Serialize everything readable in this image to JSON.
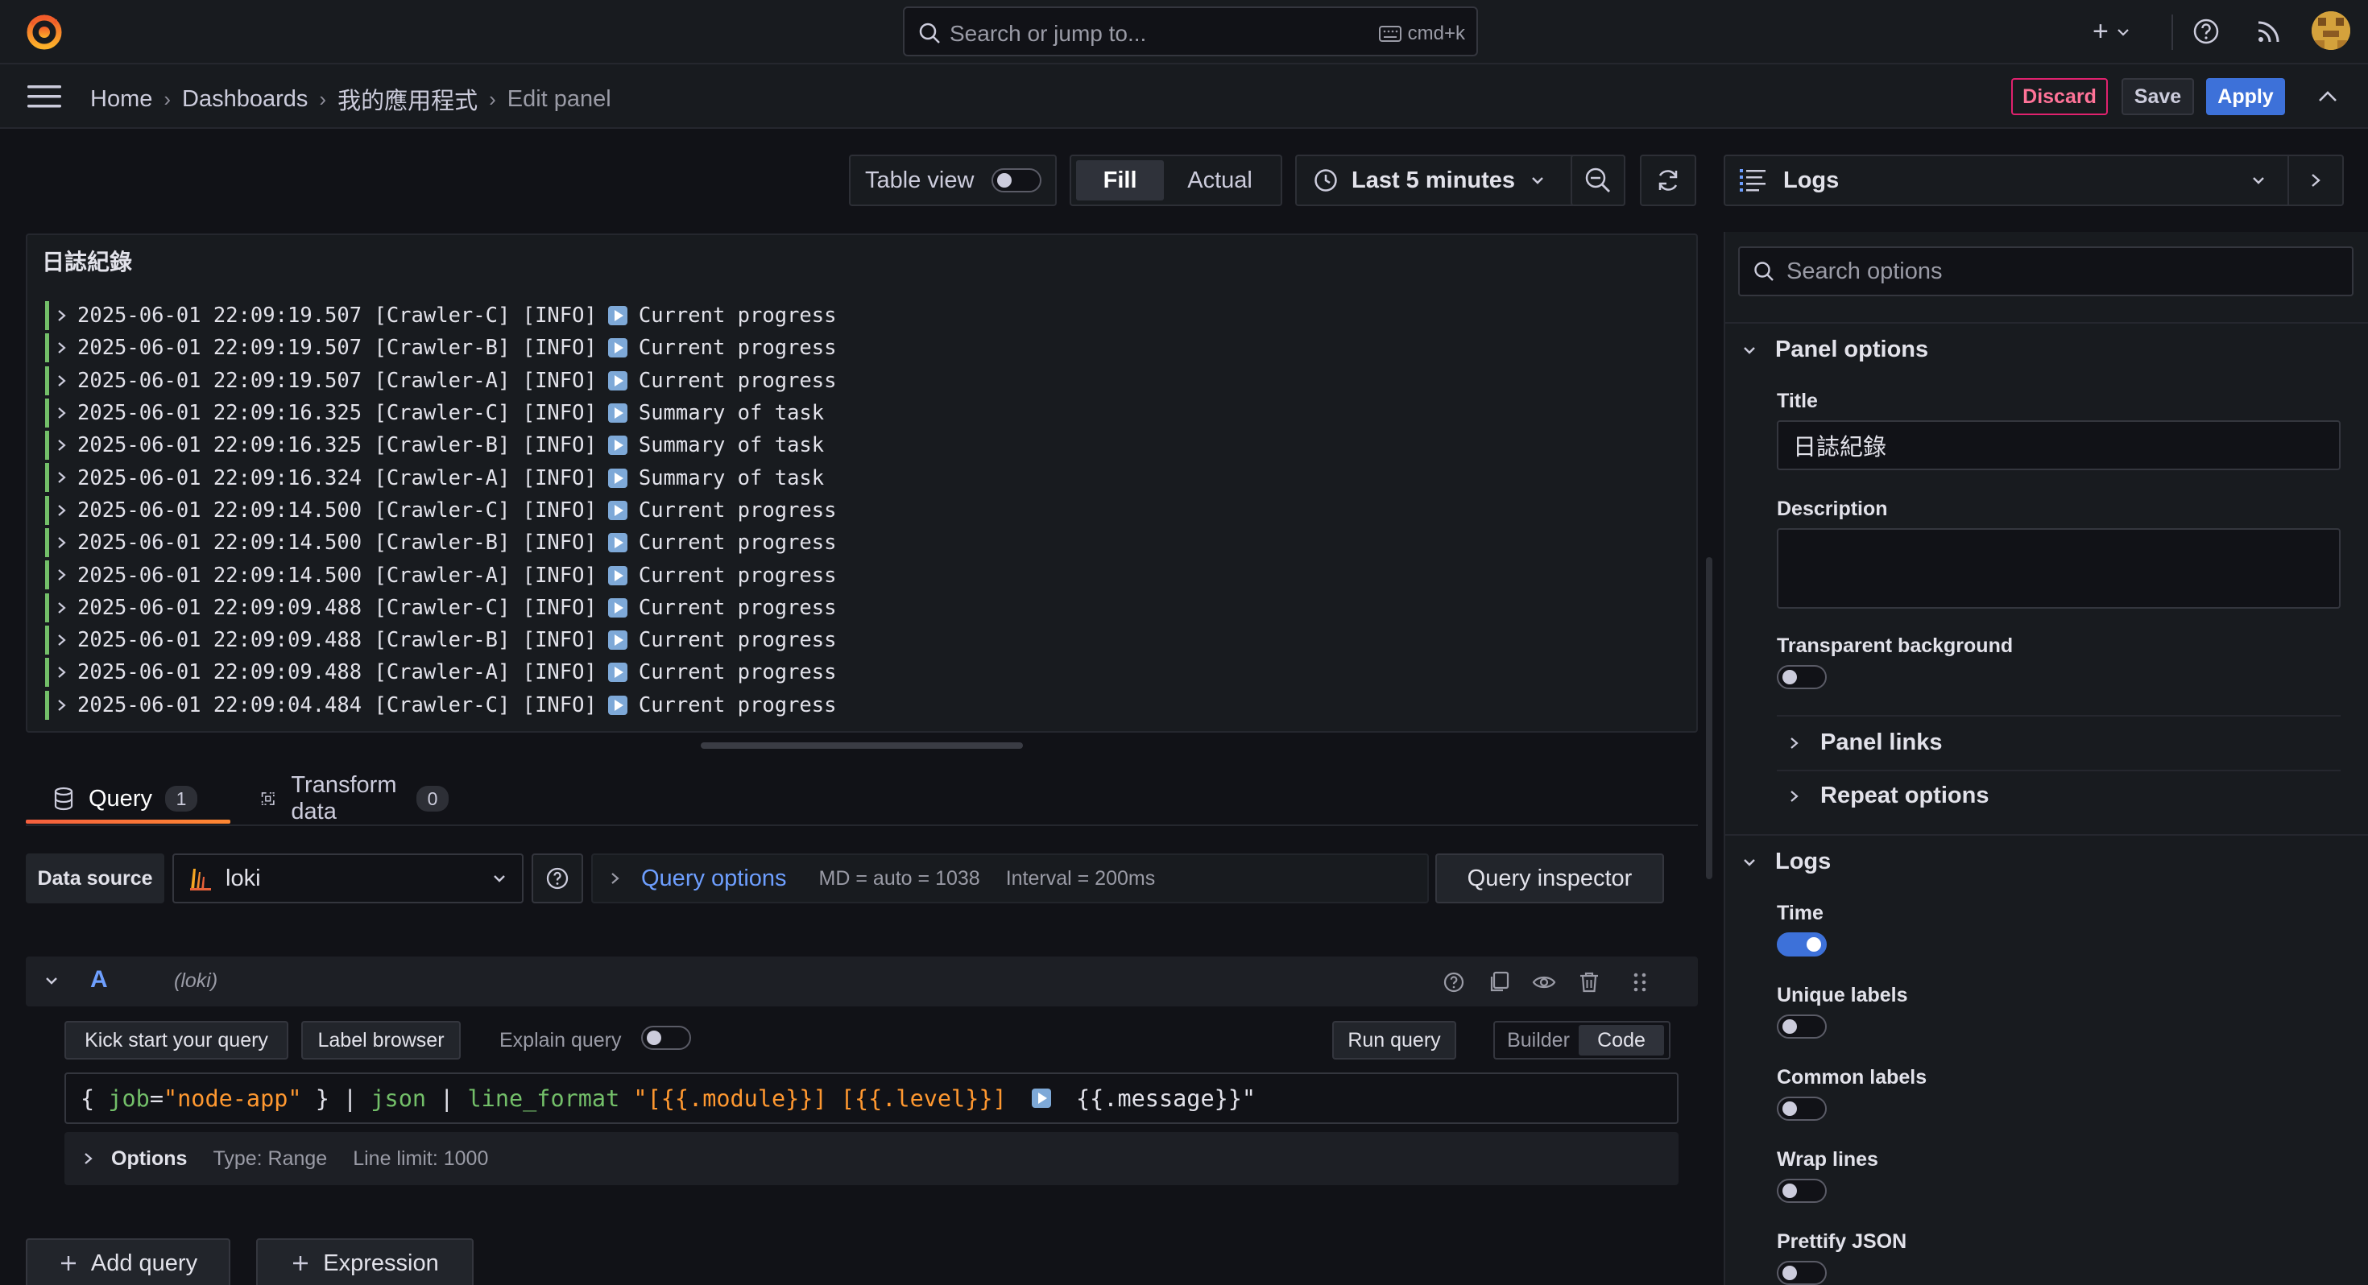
{
  "topbar": {
    "search_placeholder": "Search or jump to...",
    "search_shortcut": "cmd+k",
    "plus_label": "+"
  },
  "breadcrumb": {
    "items": [
      "Home",
      "Dashboards",
      "我的應用程式"
    ],
    "current": "Edit panel"
  },
  "actions": {
    "discard": "Discard",
    "save": "Save",
    "apply": "Apply"
  },
  "toolbar": {
    "table_view": "Table view",
    "fill": "Fill",
    "actual": "Actual",
    "time_range": "Last 5 minutes"
  },
  "visualization": {
    "type": "Logs"
  },
  "panel": {
    "title": "日誌紀錄",
    "log_lines": [
      {
        "ts": "2025-06-01 22:09:19.507",
        "module": "[Crawler-C]",
        "level": "[INFO]",
        "msg": "Current progress"
      },
      {
        "ts": "2025-06-01 22:09:19.507",
        "module": "[Crawler-B]",
        "level": "[INFO]",
        "msg": "Current progress"
      },
      {
        "ts": "2025-06-01 22:09:19.507",
        "module": "[Crawler-A]",
        "level": "[INFO]",
        "msg": "Current progress"
      },
      {
        "ts": "2025-06-01 22:09:16.325",
        "module": "[Crawler-C]",
        "level": "[INFO]",
        "msg": "Summary of task"
      },
      {
        "ts": "2025-06-01 22:09:16.325",
        "module": "[Crawler-B]",
        "level": "[INFO]",
        "msg": "Summary of task"
      },
      {
        "ts": "2025-06-01 22:09:16.324",
        "module": "[Crawler-A]",
        "level": "[INFO]",
        "msg": "Summary of task"
      },
      {
        "ts": "2025-06-01 22:09:14.500",
        "module": "[Crawler-C]",
        "level": "[INFO]",
        "msg": "Current progress"
      },
      {
        "ts": "2025-06-01 22:09:14.500",
        "module": "[Crawler-B]",
        "level": "[INFO]",
        "msg": "Current progress"
      },
      {
        "ts": "2025-06-01 22:09:14.500",
        "module": "[Crawler-A]",
        "level": "[INFO]",
        "msg": "Current progress"
      },
      {
        "ts": "2025-06-01 22:09:09.488",
        "module": "[Crawler-C]",
        "level": "[INFO]",
        "msg": "Current progress"
      },
      {
        "ts": "2025-06-01 22:09:09.488",
        "module": "[Crawler-B]",
        "level": "[INFO]",
        "msg": "Current progress"
      },
      {
        "ts": "2025-06-01 22:09:09.488",
        "module": "[Crawler-A]",
        "level": "[INFO]",
        "msg": "Current progress"
      },
      {
        "ts": "2025-06-01 22:09:04.484",
        "module": "[Crawler-C]",
        "level": "[INFO]",
        "msg": "Current progress"
      }
    ]
  },
  "tabs": {
    "query": {
      "label": "Query",
      "count": "1"
    },
    "transform": {
      "label": "Transform data",
      "count": "0"
    }
  },
  "query_bar": {
    "data_source_label": "Data source",
    "data_source": "loki",
    "query_options": "Query options",
    "md": "MD = auto = 1038",
    "interval": "Interval = 200ms",
    "inspector": "Query inspector"
  },
  "query_row": {
    "ref_id": "A",
    "ds": "(loki)",
    "kick_start": "Kick start your query",
    "label_browser": "Label browser",
    "explain": "Explain query",
    "run": "Run query",
    "builder": "Builder",
    "code": "Code",
    "expr": {
      "open": "{ ",
      "key": "job",
      "eq": "=",
      "val": "\"node-app\"",
      "close": " } | ",
      "json": "json",
      "pipe": " | ",
      "fn": "line_format",
      "str_a": " \"[{{.module}}] [{{.level}}] ",
      "str_b": " {{.message}}\""
    },
    "options_label": "Options",
    "type": "Type: Range",
    "line_limit": "Line limit: 1000"
  },
  "bottom": {
    "add_query": "Add query",
    "expression": "Expression"
  },
  "options_pane": {
    "search_placeholder": "Search options",
    "panel_options": "Panel options",
    "title_label": "Title",
    "title_value": "日誌紀錄",
    "description_label": "Description",
    "transparent_label": "Transparent background",
    "panel_links": "Panel links",
    "repeat_options": "Repeat options",
    "logs_section": "Logs",
    "time_label": "Time",
    "unique_labels": "Unique labels",
    "common_labels": "Common labels",
    "wrap_lines": "Wrap lines",
    "prettify_json": "Prettify JSON"
  },
  "colors": {
    "accent": "#3d71d9",
    "discard": "#e0226e",
    "log_bar": "#73bf69",
    "tab_underline": "#f55f3e"
  }
}
